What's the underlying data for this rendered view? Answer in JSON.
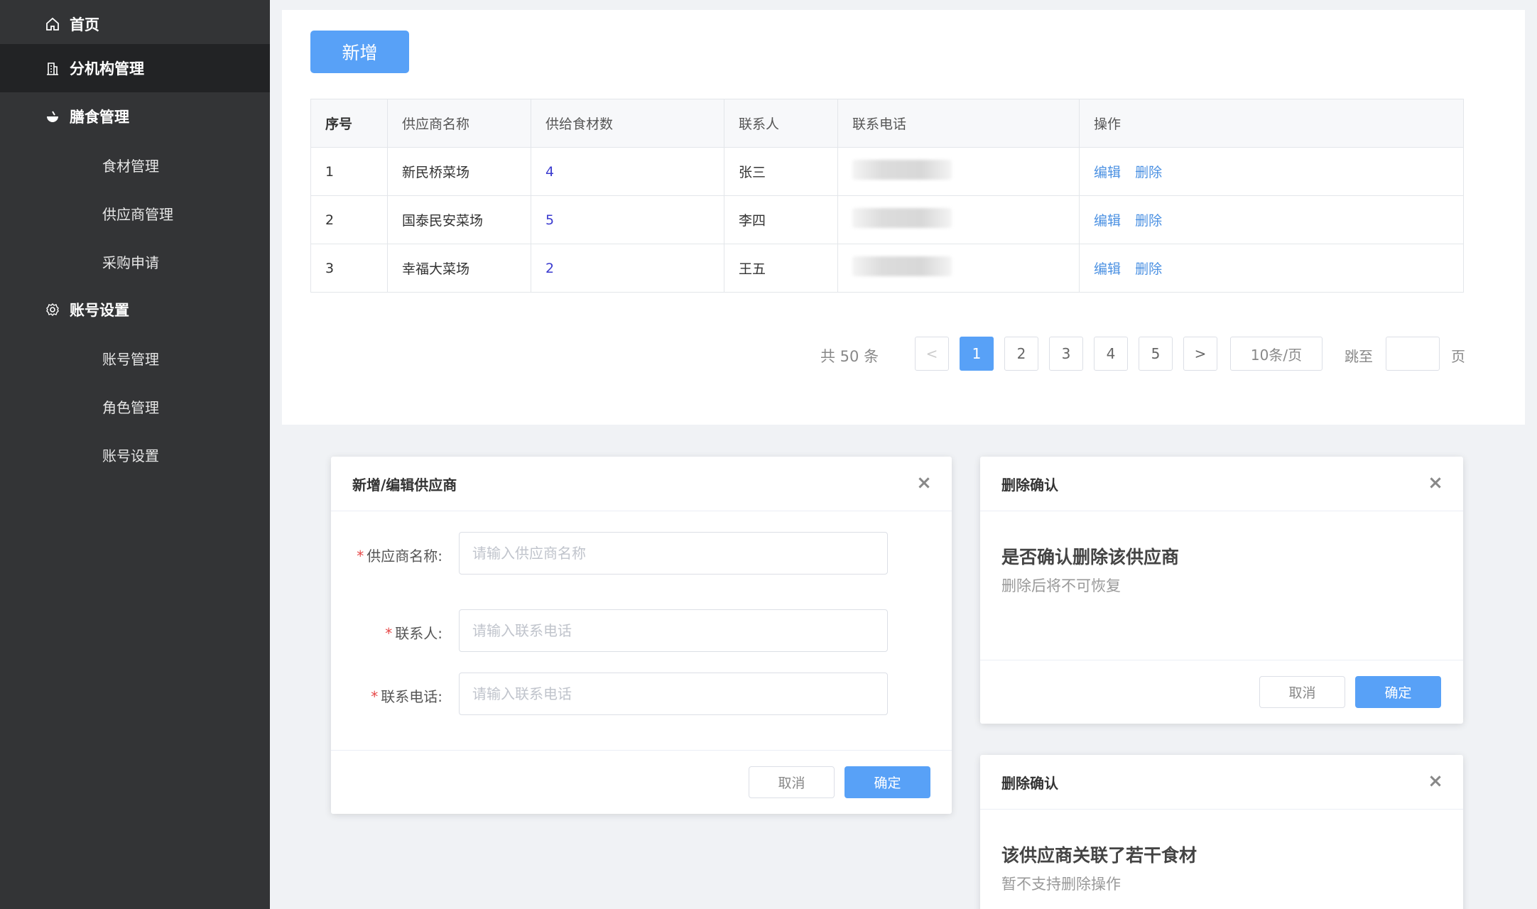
{
  "sidebar": {
    "items": [
      {
        "label": "首页",
        "icon": "home-icon"
      },
      {
        "label": "分机构管理",
        "icon": "building-icon"
      },
      {
        "label": "膳食管理",
        "icon": "bowl-icon"
      },
      {
        "label": "食材管理"
      },
      {
        "label": "供应商管理"
      },
      {
        "label": "采购申请"
      },
      {
        "label": "账号设置",
        "icon": "gear-icon"
      },
      {
        "label": "账号管理"
      },
      {
        "label": "角色管理"
      },
      {
        "label": "账号设置"
      }
    ]
  },
  "toolbar": {
    "add_label": "新增"
  },
  "table": {
    "headers": [
      "序号",
      "供应商名称",
      "供给食材数",
      "联系人",
      "联系电话",
      "操作"
    ],
    "rows": [
      {
        "index": "1",
        "name": "新民桥菜场",
        "count": "4",
        "contact": "张三"
      },
      {
        "index": "2",
        "name": "国泰民安菜场",
        "count": "5",
        "contact": "李四"
      },
      {
        "index": "3",
        "name": "幸福大菜场",
        "count": "2",
        "contact": "王五"
      }
    ],
    "edit_label": "编辑",
    "delete_label": "删除"
  },
  "pagination": {
    "total": "共 50 条",
    "prev": "<",
    "next": ">",
    "pages": [
      "1",
      "2",
      "3",
      "4",
      "5"
    ],
    "current": "1",
    "page_size": "10条/页",
    "jump_label": "跳至",
    "page_suffix": "页"
  },
  "edit_dialog": {
    "title": "新增/编辑供应商",
    "fields": [
      {
        "label": "供应商名称:",
        "placeholder": "请输入供应商名称"
      },
      {
        "label": "联系人:",
        "placeholder": "请输入联系电话"
      },
      {
        "label": "联系电话:",
        "placeholder": "请输入联系电话"
      }
    ],
    "cancel": "取消",
    "ok": "确定"
  },
  "delete_dialog": {
    "title": "删除确认",
    "message": "是否确认删除该供应商",
    "sub": "删除后将不可恢复",
    "cancel": "取消",
    "ok": "确定"
  },
  "blocked_dialog": {
    "title": "删除确认",
    "message": "该供应商关联了若干食材",
    "sub": "暂不支持删除操作"
  },
  "colors": {
    "primary": "#58a1f7",
    "sidebar": "#333436",
    "sidebar_active": "#222325",
    "link": "#4a90e2",
    "required": "#e64848"
  }
}
